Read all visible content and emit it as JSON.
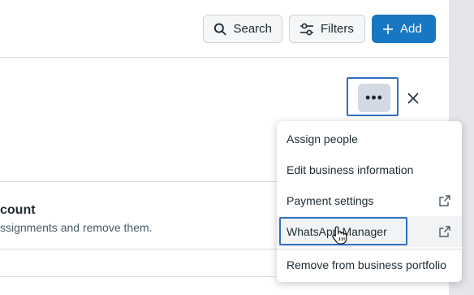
{
  "toolbar": {
    "search_label": "Search",
    "filters_label": "Filters",
    "add_label": "Add"
  },
  "panel": {
    "more_label": "•••",
    "account_title": "count",
    "account_desc": "ssignments and remove them."
  },
  "menu": {
    "items": [
      {
        "label": "Assign people",
        "external": false
      },
      {
        "label": "Edit business information",
        "external": false
      },
      {
        "label": "Payment settings",
        "external": true
      },
      {
        "label": "WhatsApp Manager",
        "external": true,
        "highlighted": true
      },
      {
        "label": "Remove from business portfolio",
        "external": false
      }
    ]
  },
  "colors": {
    "primary": "#1877c2",
    "highlight_border": "#2f6fc2"
  }
}
